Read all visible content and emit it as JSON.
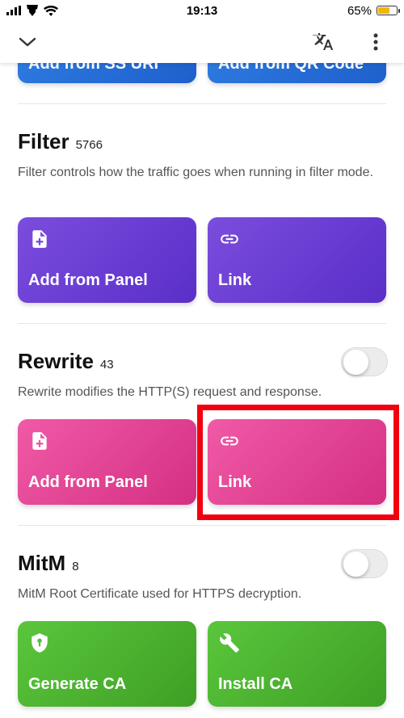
{
  "status_bar": {
    "time": "19:13",
    "battery": "65%",
    "battery_level": 0.65
  },
  "toolbar": {
    "collapse_icon": "chevron-down-icon",
    "translate_icon": "translate-icon",
    "more_icon": "more-vert-icon"
  },
  "top_section": {
    "buttons": [
      "Add from SS URI",
      "Add from QR Code"
    ]
  },
  "filter": {
    "title": "Filter",
    "count": "5766",
    "description": "Filter controls how the traffic goes when running in filter mode.",
    "buttons": [
      "Add from Panel",
      "Link"
    ]
  },
  "rewrite": {
    "title": "Rewrite",
    "count": "43",
    "description": "Rewrite modifies the HTTP(S) request and response.",
    "enabled": false,
    "buttons": [
      "Add from Panel",
      "Link"
    ]
  },
  "mitm": {
    "title": "MitM",
    "count": "8",
    "description": "MitM Root Certificate used for HTTPS decryption.",
    "enabled": false,
    "buttons": [
      "Generate CA",
      "Install CA"
    ]
  },
  "colors": {
    "filter": "#6a3ed4",
    "rewrite": "#e2448f",
    "mitm": "#4db531",
    "highlight": "#f2000f"
  }
}
